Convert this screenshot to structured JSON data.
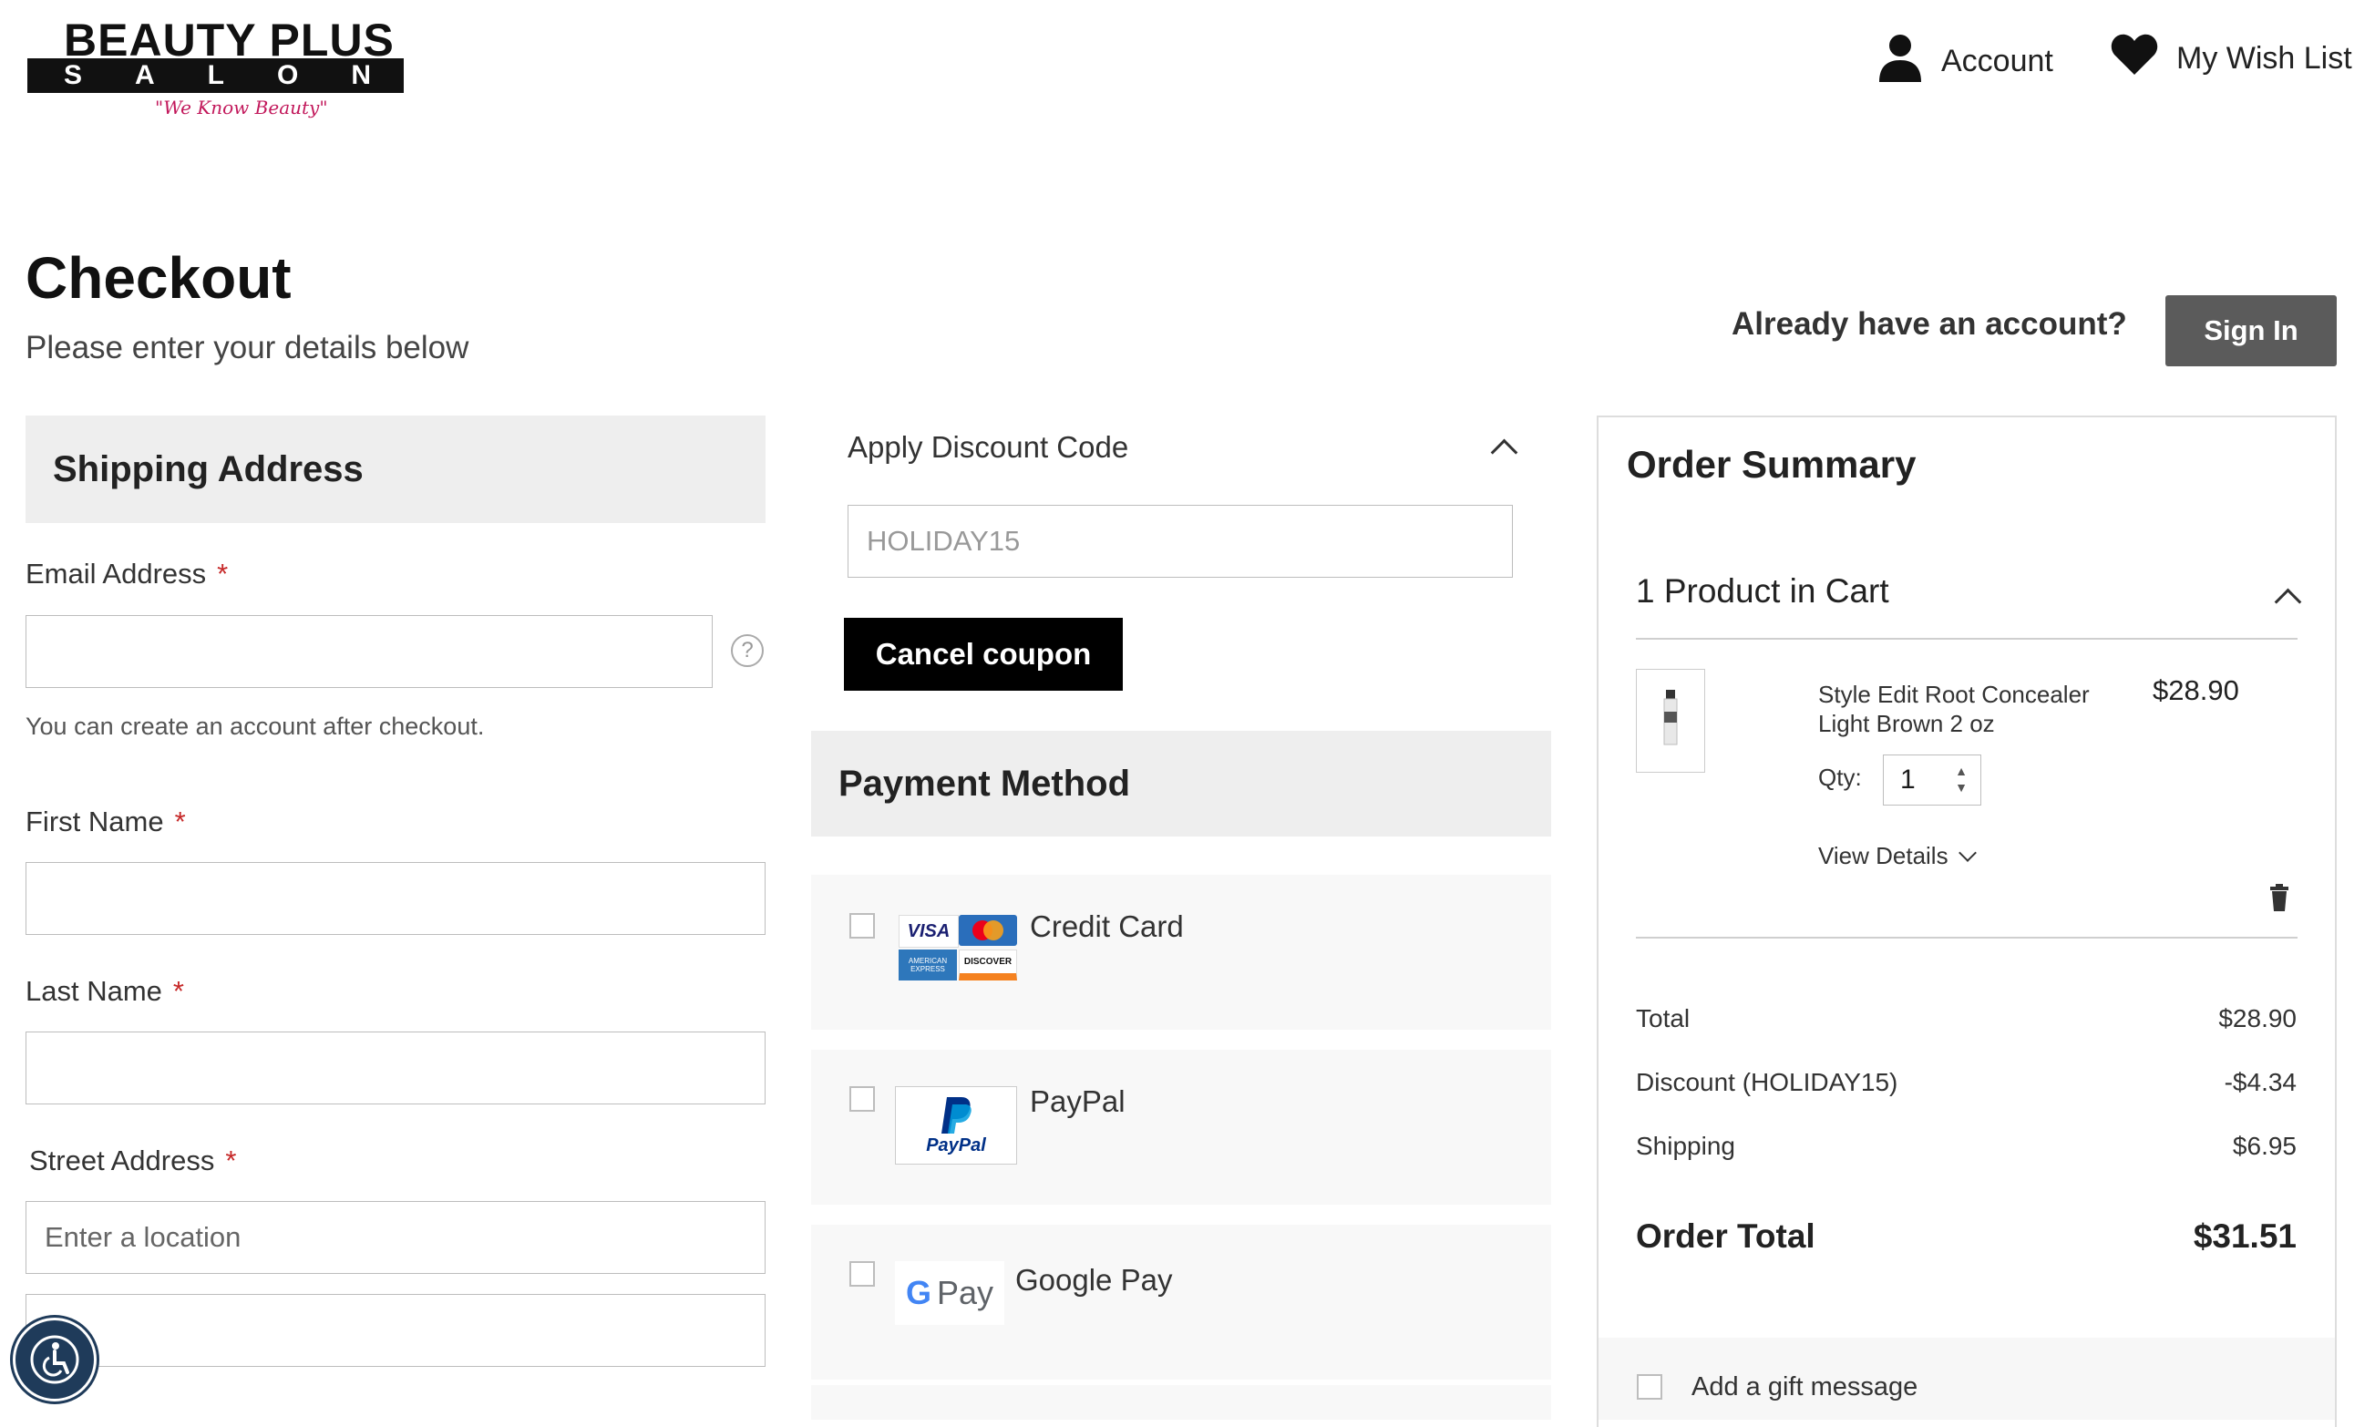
{
  "header": {
    "logo_top": "BEAUTY PLUS",
    "logo_bar": "SALON",
    "logo_tagline": "\"We Know Beauty\"",
    "account_label": "Account",
    "wishlist_label": "My Wish List"
  },
  "page": {
    "title": "Checkout",
    "subtitle": "Please enter your details below",
    "already_account": "Already have an account?",
    "sign_in": "Sign In"
  },
  "shipping": {
    "heading": "Shipping Address",
    "email_label": "Email Address",
    "email_value": "",
    "email_note": "You can create an account after checkout.",
    "first_name_label": "First Name",
    "last_name_label": "Last Name",
    "street_label": "Street Address",
    "street_placeholder": "Enter a location",
    "required_mark": "*"
  },
  "discount": {
    "label": "Apply Discount Code",
    "code_value": "HOLIDAY15",
    "cancel_label": "Cancel coupon"
  },
  "payment": {
    "heading": "Payment Method",
    "options": [
      {
        "label": "Credit Card"
      },
      {
        "label": "PayPal"
      },
      {
        "label": "Google Pay"
      }
    ],
    "card_logos": [
      "VISA",
      "mastercard",
      "AMERICAN EXPRESS",
      "DISCOVER"
    ],
    "paypal_logo_text": "PayPal",
    "gpay_logo_text": "Pay"
  },
  "summary": {
    "title": "Order Summary",
    "cart_count": "1 Product in Cart",
    "product": {
      "name": "Style Edit Root Concealer Light Brown 2 oz",
      "price": "$28.90",
      "qty_label": "Qty:",
      "qty": "1",
      "view_details": "View Details"
    },
    "totals": [
      {
        "label": "Total",
        "value": "$28.90"
      },
      {
        "label": "Discount (HOLIDAY15)",
        "value": "-$4.34"
      },
      {
        "label": "Shipping",
        "value": "$6.95"
      }
    ],
    "order_total_label": "Order Total",
    "order_total_value": "$31.51",
    "gift_label": "Add a gift message"
  },
  "colors": {
    "accent_black": "#000000",
    "sign_in_bg": "#5b5b5b",
    "required": "#c62828",
    "section_bg": "#eeeeee"
  }
}
